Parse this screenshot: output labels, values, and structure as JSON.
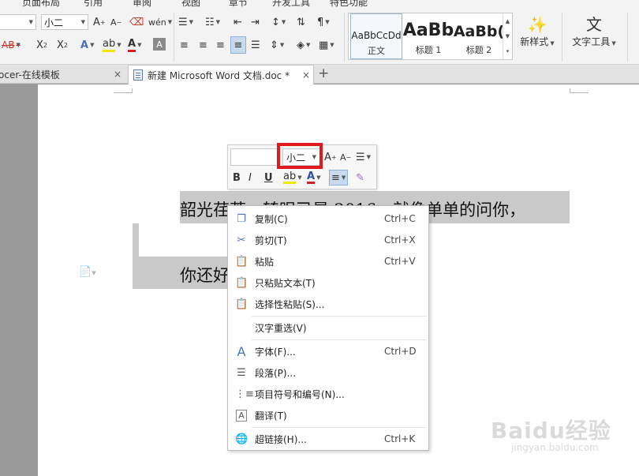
{
  "menubar": {
    "items": [
      "页面布局",
      "引用",
      "审阅",
      "视图",
      "章节",
      "开发工具",
      "特色功能"
    ]
  },
  "ribbon": {
    "font_size_value": "小二",
    "styles": [
      {
        "sample": "AaBbCcDd",
        "label": "正文"
      },
      {
        "sample": "AaBb",
        "label": "标题 1"
      },
      {
        "sample": "AaBb(",
        "label": "标题 2"
      }
    ],
    "new_style_label": "新样式",
    "text_tools_label": "文字工具"
  },
  "tabs": [
    {
      "title": "ocer-在线模板",
      "active": false
    },
    {
      "title": "新建 Microsoft Word 文档.doc *",
      "active": true
    }
  ],
  "document": {
    "line1": "韶光荏苒，转眼已是 2016，就像单单的问你，",
    "line2": "你还好"
  },
  "mini_toolbar": {
    "font_size": "小二",
    "grow_label": "A",
    "shrink_label": "A",
    "bold": "B",
    "italic": "I",
    "underline": "U"
  },
  "context_menu": {
    "items": [
      {
        "icon": "copy-icon",
        "label": "复制(C)",
        "shortcut": "Ctrl+C"
      },
      {
        "icon": "scissors-icon",
        "label": "剪切(T)",
        "shortcut": "Ctrl+X"
      },
      {
        "icon": "paste-icon",
        "label": "粘贴",
        "shortcut": "Ctrl+V"
      },
      {
        "icon": "paste-text-icon",
        "label": "只粘贴文本(T)",
        "shortcut": ""
      },
      {
        "icon": "paste-special-icon",
        "label": "选择性粘贴(S)...",
        "shortcut": ""
      },
      {
        "icon": "",
        "label": "汉字重选(V)",
        "shortcut": ""
      },
      {
        "icon": "font-icon",
        "label": "字体(F)...",
        "shortcut": "Ctrl+D"
      },
      {
        "icon": "paragraph-icon",
        "label": "段落(P)...",
        "shortcut": ""
      },
      {
        "icon": "bullets-icon",
        "label": "项目符号和编号(N)...",
        "shortcut": ""
      },
      {
        "icon": "translate-icon",
        "label": "翻译(T)",
        "shortcut": ""
      },
      {
        "icon": "hyperlink-icon",
        "label": "超链接(H)...",
        "shortcut": "Ctrl+K"
      }
    ]
  },
  "watermark": {
    "brand": "Baidu经验",
    "url": "jingyan.baidu.com"
  },
  "colors": {
    "highlight": "#c9c9c9",
    "red_annotation": "#e0191e",
    "icon_blue": "#4a72b8"
  }
}
